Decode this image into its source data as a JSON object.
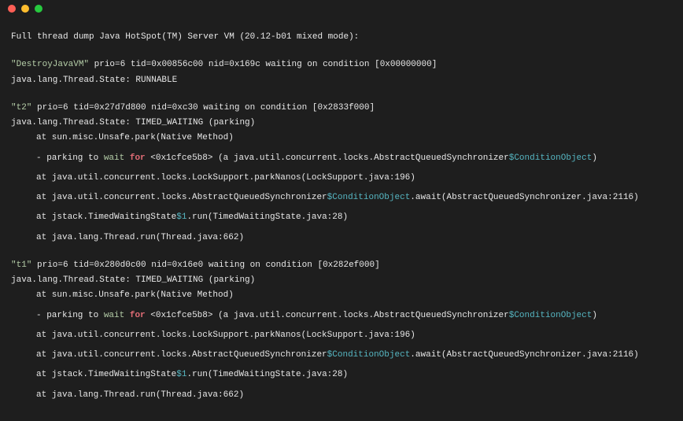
{
  "header": "Full thread dump Java HotSpot(TM) Server VM (20.12-b01 mixed mode):",
  "threads": {
    "destroy": {
      "name": "\"DestroyJavaVM\"",
      "rest": " prio=6 tid=0x00856c00 nid=0x169c waiting on condition [0x00000000]",
      "state": "java.lang.Thread.State: RUNNABLE"
    },
    "t2": {
      "name": "\"t2\"",
      "rest": " prio=6 tid=0x27d7d800 nid=0xc30 waiting on condition [0x2833f000]",
      "state": "java.lang.Thread.State: TIMED_WAITING (parking)",
      "l1": "at sun.misc.Unsafe.park(Native Method)",
      "l2a": "- parking to ",
      "l2b": "wait",
      "l2c": " ",
      "l2d": "for",
      "l2e": "  <0x1cfce5b8> (a java.util.concurrent.locks.AbstractQueuedSynchronizer",
      "l2f": "$ConditionObject",
      "l2g": ")",
      "l3": "at java.util.concurrent.locks.LockSupport.parkNanos(LockSupport.java:196)",
      "l4a": "at java.util.concurrent.locks.AbstractQueuedSynchronizer",
      "l4b": "$ConditionObject",
      "l4c": ".await(AbstractQueuedSynchronizer.java:2116)",
      "l5a": "at jstack.TimedWaitingState",
      "l5b": "$1",
      "l5c": ".run(TimedWaitingState.java:28)",
      "l6": "at java.lang.Thread.run(Thread.java:662)"
    },
    "t1": {
      "name": "\"t1\"",
      "rest": " prio=6 tid=0x280d0c00 nid=0x16e0 waiting on condition [0x282ef000]",
      "state": "java.lang.Thread.State: TIMED_WAITING (parking)",
      "l1": "at sun.misc.Unsafe.park(Native Method)",
      "l2a": "- parking to ",
      "l2b": "wait",
      "l2c": " ",
      "l2d": "for",
      "l2e": "  <0x1cfce5b8> (a java.util.concurrent.locks.AbstractQueuedSynchronizer",
      "l2f": "$ConditionObject",
      "l2g": ")",
      "l3": "at java.util.concurrent.locks.LockSupport.parkNanos(LockSupport.java:196)",
      "l4a": "at java.util.concurrent.locks.AbstractQueuedSynchronizer",
      "l4b": "$ConditionObject",
      "l4c": ".await(AbstractQueuedSynchronizer.java:2116)",
      "l5a": "at jstack.TimedWaitingState",
      "l5b": "$1",
      "l5c": ".run(TimedWaitingState.java:28)",
      "l6": "at java.lang.Thread.run(Thread.java:662)"
    }
  }
}
